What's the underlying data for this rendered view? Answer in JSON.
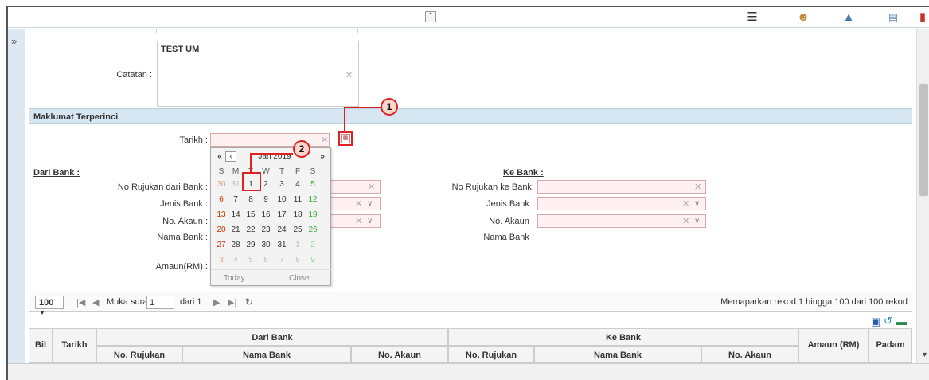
{
  "toolbar": {
    "collapse_icon": "double-chevron-up-icon",
    "menu_icon": "hamburger-icon",
    "user_icon": "user-icon",
    "lock_icon": "lock-icon",
    "list_icon": "list-icon",
    "exit_icon": "exit-icon"
  },
  "sidebar": {
    "expand_symbol": "»"
  },
  "form": {
    "catatan_label": "Catatan :",
    "catatan_value": "TEST UM",
    "section_title": "Maklumat Terperinci",
    "tarikh_label": "Tarikh :",
    "dari_bank_heading": "Dari Bank :",
    "ke_bank_heading": "Ke Bank :",
    "no_rujukan_dari_label": "No Rujukan dari Bank :",
    "jenis_bank_label": "Jenis Bank :",
    "no_akaun_label": "No. Akaun :",
    "nama_bank_label": "Nama Bank :",
    "amaun_label": "Amaun(RM) :",
    "no_rujukan_ke_label": "No Rujukan ke Bank:",
    "ke_jenis_bank_label": "Jenis Bank :",
    "ke_no_akaun_label": "No. Akaun :",
    "ke_nama_bank_label": "Nama Bank :"
  },
  "calendar": {
    "month_label": "Jan 2019",
    "prev_year": "«",
    "prev_month": "‹",
    "next_year": "»",
    "weekdays": [
      "S",
      "M",
      "T",
      "W",
      "T",
      "F",
      "S"
    ],
    "weeks": [
      [
        "30",
        "31",
        "1",
        "2",
        "3",
        "4",
        "5"
      ],
      [
        "6",
        "7",
        "8",
        "9",
        "10",
        "11",
        "12"
      ],
      [
        "13",
        "14",
        "15",
        "16",
        "17",
        "18",
        "19"
      ],
      [
        "20",
        "21",
        "22",
        "23",
        "24",
        "25",
        "26"
      ],
      [
        "27",
        "28",
        "29",
        "30",
        "31",
        "1",
        "2"
      ],
      [
        "3",
        "4",
        "5",
        "6",
        "7",
        "8",
        "9"
      ]
    ],
    "today_label": "Today",
    "close_label": "Close"
  },
  "annotations": {
    "one": "1",
    "two": "2"
  },
  "pager": {
    "page_size": "100",
    "page_label": "Muka surat",
    "page_value": "1",
    "of_label": "dari 1",
    "summary": "Memaparkan rekod 1 hingga 100 dari 100 rekod"
  },
  "grid": {
    "bil": "Bil",
    "tarikh": "Tarikh",
    "dari_bank": "Dari Bank",
    "ke_bank": "Ke Bank",
    "no_rujukan": "No. Rujukan",
    "nama_bank": "Nama Bank",
    "no_akaun": "No. Akaun",
    "amaun": "Amaun (RM)",
    "padam": "Padam"
  },
  "colors": {
    "annotation": "#dd2222",
    "weekend_red": "#cc3300",
    "weekend_green": "#33aa33",
    "section_bg": "#d6e6f2"
  }
}
